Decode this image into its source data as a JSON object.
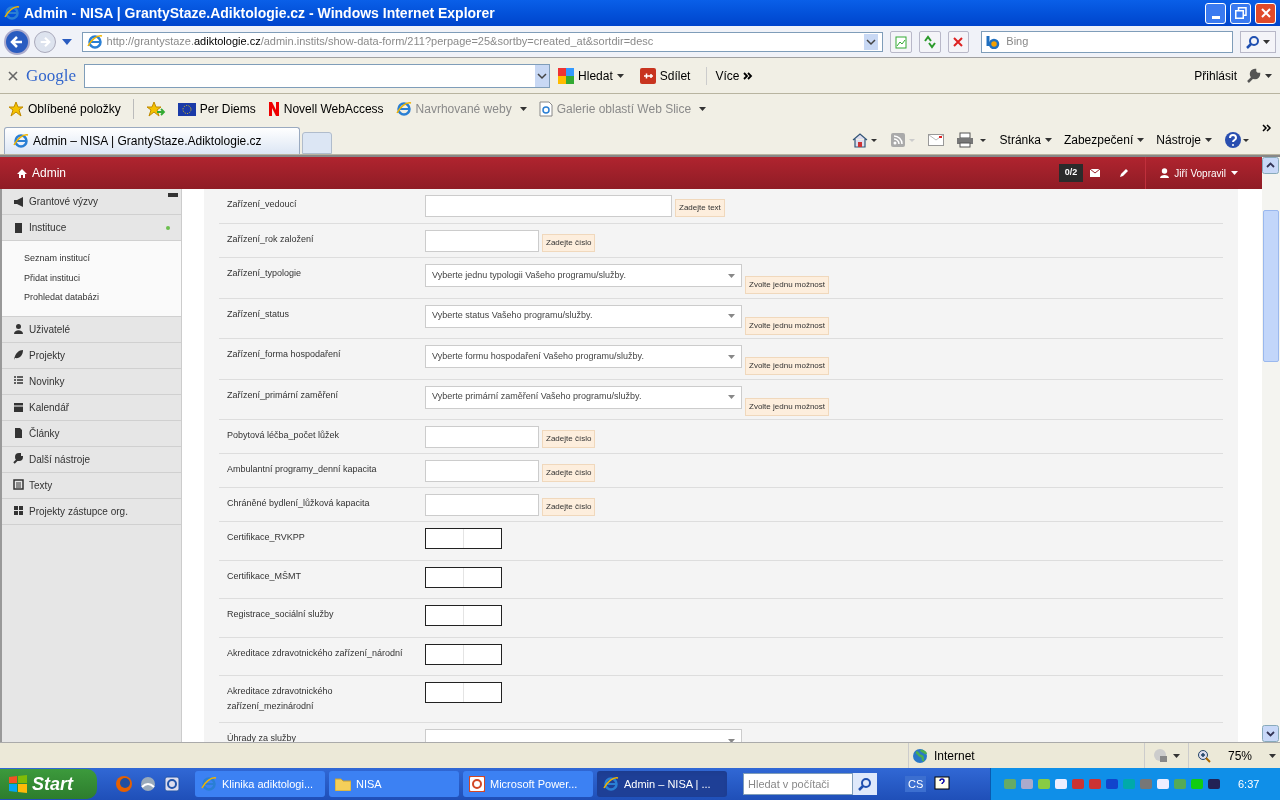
{
  "window": {
    "title": "Admin - NISA | GrantyStaze.Adiktologie.cz - Windows Internet Explorer"
  },
  "address_bar": {
    "url_prefix": "http://grantystaze.",
    "url_domain": "adiktologie.cz",
    "url_path": "/admin.instits/show-data-form/211?perpage=25&sortby=created_at&sortdir=desc"
  },
  "search_box": {
    "placeholder": "Bing"
  },
  "google_toolbar": {
    "brand": "Google",
    "search_button": "Hledat",
    "share_button": "Sdílet",
    "more_button": "Více",
    "sign_in": "Přihlásit"
  },
  "favorites_bar": [
    {
      "label": "Oblíbené položky",
      "kind": "star",
      "disabled": false,
      "dropdown": false
    },
    {
      "label": "Per Diems",
      "kind": "flag",
      "disabled": false,
      "dropdown": false
    },
    {
      "label": "Novell WebAccess",
      "kind": "letter",
      "disabled": false,
      "dropdown": false
    },
    {
      "label": "Navrhované weby",
      "kind": "ie",
      "disabled": true,
      "dropdown": true
    },
    {
      "label": "Galerie oblastí Web Slice",
      "kind": "page",
      "disabled": true,
      "dropdown": true
    }
  ],
  "tabs": [
    {
      "label": "Admin – NISA | GrantyStaze.Adiktologie.cz",
      "selected": true
    }
  ],
  "command_bar": [
    "Stránka",
    "Zabezpečení",
    "Nástroje"
  ],
  "admin_header": {
    "brand": "Admin",
    "message_count": "0/2",
    "user": "Jiří Vopravil"
  },
  "sidebar": [
    {
      "label": "Grantové výzvy",
      "selected": false
    },
    {
      "label": "Instituce",
      "selected": true,
      "children": [
        {
          "label": "Seznam institucí"
        },
        {
          "label": "Přidat instituci"
        },
        {
          "label": "Prohledat databázi"
        }
      ]
    },
    {
      "label": "Uživatelé",
      "selected": false
    },
    {
      "label": "Projekty",
      "selected": false
    },
    {
      "label": "Novinky",
      "selected": false
    },
    {
      "label": "Kalendář",
      "selected": false
    },
    {
      "label": "Články",
      "selected": false
    },
    {
      "label": "Další nástroje",
      "selected": false
    },
    {
      "label": "Texty",
      "selected": false
    },
    {
      "label": "Projekty zástupce org.",
      "selected": false
    }
  ],
  "form_rows": [
    {
      "label": "Zařízení_vedoucí",
      "kind": "text",
      "hint": "Zadejte text"
    },
    {
      "label": "Zařízení_rok založení",
      "kind": "number",
      "hint": "Zadejte číslo"
    },
    {
      "label": "Zařízení_typologie",
      "kind": "select",
      "placeholder": "Vyberte jednu typologii Vašeho programu/služby.",
      "hint": "Zvolte jednu možnost"
    },
    {
      "label": "Zařízení_status",
      "kind": "select",
      "placeholder": "Vyberte status Vašeho programu/služby.",
      "hint": "Zvolte jednu možnost"
    },
    {
      "label": "Zařízení_forma hospodaření",
      "kind": "select",
      "placeholder": "Vyberte formu hospodaření Vašeho programu/služby.",
      "hint": "Zvolte jednu možnost"
    },
    {
      "label": "Zařízení_primární zaměření",
      "kind": "select",
      "placeholder": "Vyberte primární zaměření Vašeho programu/služby.",
      "hint": "Zvolte jednu možnost"
    },
    {
      "label": "Pobytová léčba_počet lůžek",
      "kind": "number",
      "hint": "Zadejte číslo"
    },
    {
      "label": "Ambulantní programy_denní kapacita",
      "kind": "number",
      "hint": "Zadejte číslo"
    },
    {
      "label": "Chráněné bydlení_lůžková kapacita",
      "kind": "number",
      "hint": "Zadejte číslo"
    },
    {
      "label": "Certifikace_RVKPP",
      "kind": "toggle",
      "on": false
    },
    {
      "label": "Certifikace_MŠMT",
      "kind": "toggle",
      "on": false
    },
    {
      "label": "Registrace_sociální služby",
      "kind": "toggle",
      "on": false
    },
    {
      "label": "Akreditace zdravotnického zařízení_národní",
      "kind": "toggle",
      "on": false
    },
    {
      "label": "Akreditace zdravotnického zařízení_mezinárodní",
      "kind": "toggle",
      "on": false
    },
    {
      "label": "Úhrady za služby",
      "kind": "select"
    }
  ],
  "status_bar": {
    "zone": "Internet",
    "zoom": "75%"
  },
  "taskbar": {
    "start": "Start",
    "tasks": [
      {
        "label": "Klinika adiktologi...",
        "kind": "ie",
        "selected": false
      },
      {
        "label": "NISA",
        "kind": "folder",
        "selected": false
      },
      {
        "label": "Microsoft Power...",
        "kind": "ppt",
        "selected": false
      },
      {
        "label": "Admin – NISA | ...",
        "kind": "ie",
        "selected": true
      }
    ],
    "search_placeholder": "Hledat v počítači",
    "language": "CS",
    "clock": "6:37"
  }
}
